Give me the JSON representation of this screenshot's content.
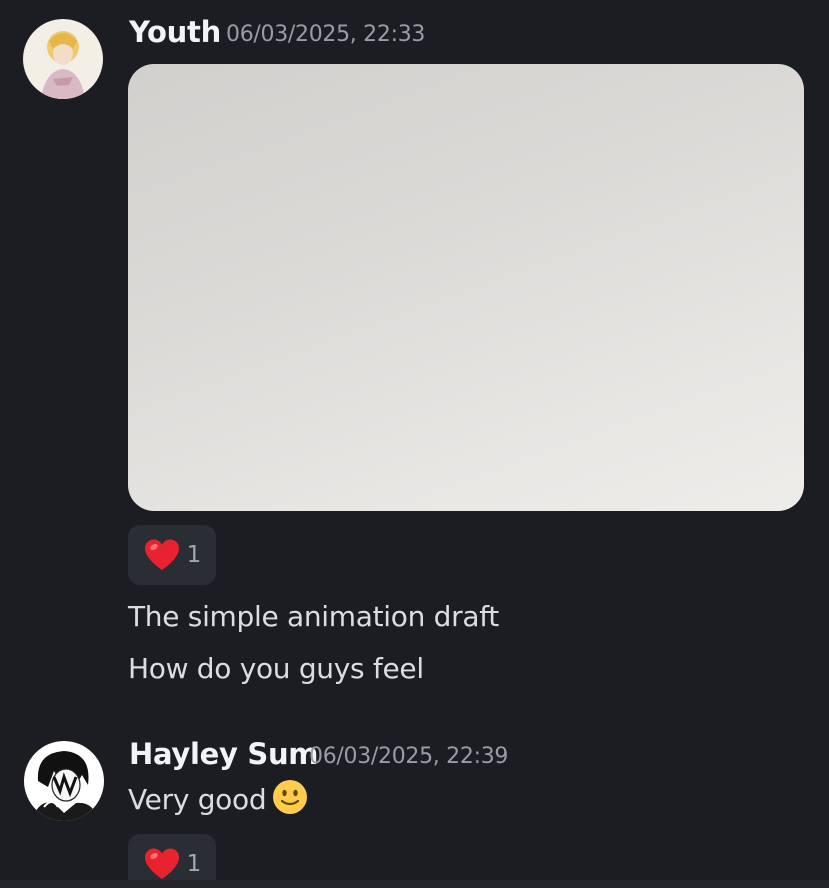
{
  "messages": [
    {
      "username": "Youth",
      "timestamp": "06/03/2025, 22:33",
      "avatar_icon": "avatar-youth-illustration",
      "attachment": "image",
      "reaction": {
        "emoji": "heart-icon",
        "count": "1"
      },
      "lines": [
        "The simple animation draft",
        "How do you guys feel"
      ]
    },
    {
      "username": "Hayley Sum",
      "timestamp": "06/03/2025, 22:39",
      "avatar_icon": "avatar-hayley-illustration",
      "text": "Very good",
      "inline_emoji": "slight-smile-icon",
      "reaction": {
        "emoji": "heart-icon",
        "count": "1"
      }
    }
  ],
  "colors": {
    "background": "#1c1d22",
    "username": "#f2f3f5",
    "timestamp": "#9a9ca4",
    "reaction_bg": "#2b2d34",
    "heart": "#e8232f"
  }
}
